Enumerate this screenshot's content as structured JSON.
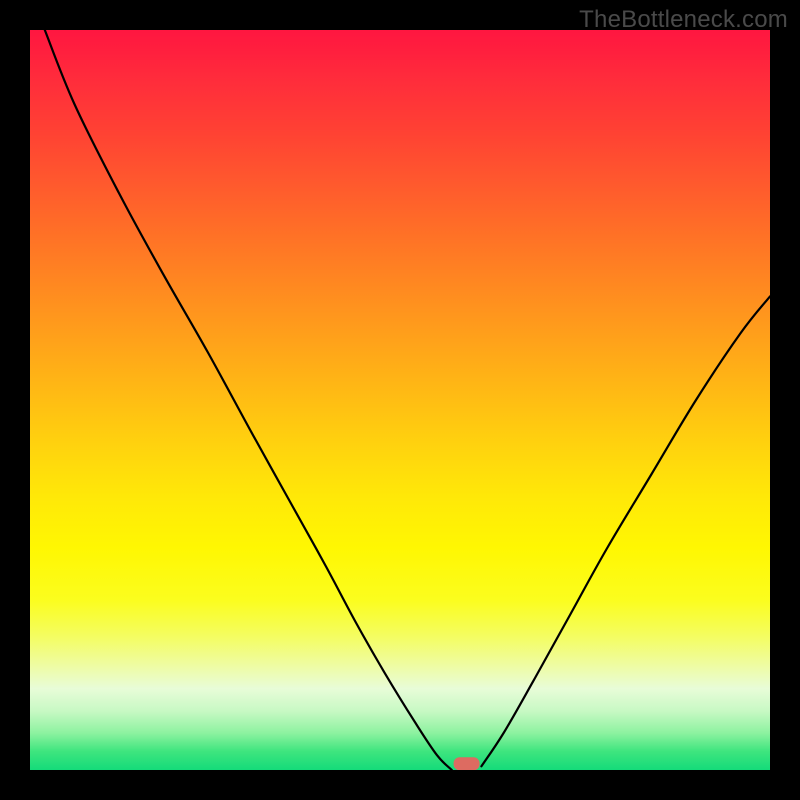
{
  "watermark": "TheBottleneck.com",
  "colors": {
    "page_bg": "#000000",
    "marker": "#dd6b61",
    "curve": "#000000",
    "gradient_top": "#ff1640",
    "gradient_bottom": "#14db7a"
  },
  "chart_data": {
    "type": "line",
    "title": "",
    "xlabel": "",
    "ylabel": "",
    "xlim": [
      0,
      100
    ],
    "ylim": [
      0,
      100
    ],
    "grid": false,
    "legend": false,
    "series": [
      {
        "name": "left-branch",
        "x": [
          2,
          6,
          12,
          18,
          24,
          30,
          35,
          40,
          44,
          48,
          52,
          55,
          57
        ],
        "y": [
          100,
          90,
          78,
          67,
          56.5,
          45.5,
          36.5,
          27.5,
          20,
          13,
          6.5,
          2,
          0
        ]
      },
      {
        "name": "right-branch",
        "x": [
          61,
          64,
          68,
          73,
          78,
          84,
          90,
          96,
          100
        ],
        "y": [
          0.5,
          5,
          12,
          21,
          30,
          40,
          50,
          59,
          64
        ]
      }
    ],
    "annotations": [
      {
        "name": "minimum-marker",
        "x": 59,
        "y": 0.5,
        "shape": "rounded-rect",
        "color": "#dd6b61"
      }
    ],
    "background_gradient": {
      "orientation": "vertical",
      "stops": [
        {
          "pos": 0.0,
          "meaning": "high-bottleneck",
          "color": "#ff1640"
        },
        {
          "pos": 0.5,
          "meaning": "",
          "color": "#ffd20e"
        },
        {
          "pos": 0.78,
          "meaning": "",
          "color": "#fbfd1e"
        },
        {
          "pos": 1.0,
          "meaning": "no-bottleneck",
          "color": "#14db7a"
        }
      ]
    }
  }
}
